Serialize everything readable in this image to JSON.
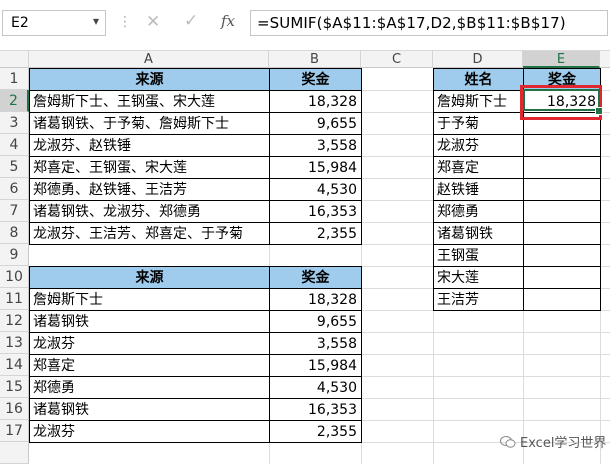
{
  "formula_bar": {
    "name_box": "E2",
    "fx": "fx",
    "formula": "=SUMIF($A$11:$A$17,D2,$B$11:$B$17)"
  },
  "columns": [
    "A",
    "B",
    "C",
    "D",
    "E"
  ],
  "rows": [
    "1",
    "2",
    "3",
    "4",
    "5",
    "6",
    "7",
    "8",
    "9",
    "10",
    "11",
    "12",
    "13",
    "14",
    "15",
    "16",
    "17"
  ],
  "table1": {
    "headers": [
      "来源",
      "奖金"
    ],
    "rows": [
      [
        "詹姆斯下士、王钢蛋、宋大莲",
        "18,328"
      ],
      [
        "诸葛钢铁、于予菊、詹姆斯下士",
        "9,655"
      ],
      [
        "龙淑芬、赵铁锤",
        "3,558"
      ],
      [
        "郑喜定、王钢蛋、宋大莲",
        "15,984"
      ],
      [
        "郑德勇、赵铁锤、王洁芳",
        "4,530"
      ],
      [
        "诸葛钢铁、龙淑芬、郑德勇",
        "16,353"
      ],
      [
        "龙淑芬、王洁芳、郑喜定、于予菊",
        "2,355"
      ]
    ]
  },
  "table2": {
    "headers": [
      "来源",
      "奖金"
    ],
    "rows": [
      [
        "詹姆斯下士",
        "18,328"
      ],
      [
        "诸葛钢铁",
        "9,655"
      ],
      [
        "龙淑芬",
        "3,558"
      ],
      [
        "郑喜定",
        "15,984"
      ],
      [
        "郑德勇",
        "4,530"
      ],
      [
        "诸葛钢铁",
        "16,353"
      ],
      [
        "龙淑芬",
        "2,355"
      ]
    ]
  },
  "table3": {
    "headers": [
      "姓名",
      "奖金"
    ],
    "rows": [
      [
        "詹姆斯下士",
        "18,328"
      ],
      [
        "于予菊",
        ""
      ],
      [
        "龙淑芬",
        ""
      ],
      [
        "郑喜定",
        ""
      ],
      [
        "赵铁锤",
        ""
      ],
      [
        "郑德勇",
        ""
      ],
      [
        "诸葛钢铁",
        ""
      ],
      [
        "王钢蛋",
        ""
      ],
      [
        "宋大莲",
        ""
      ],
      [
        "王洁芳",
        ""
      ]
    ]
  },
  "watermark": "Excel学习世界",
  "colors": {
    "header_fill": "#9fcbec",
    "highlight": "#e0262f",
    "excel_green": "#217346"
  }
}
